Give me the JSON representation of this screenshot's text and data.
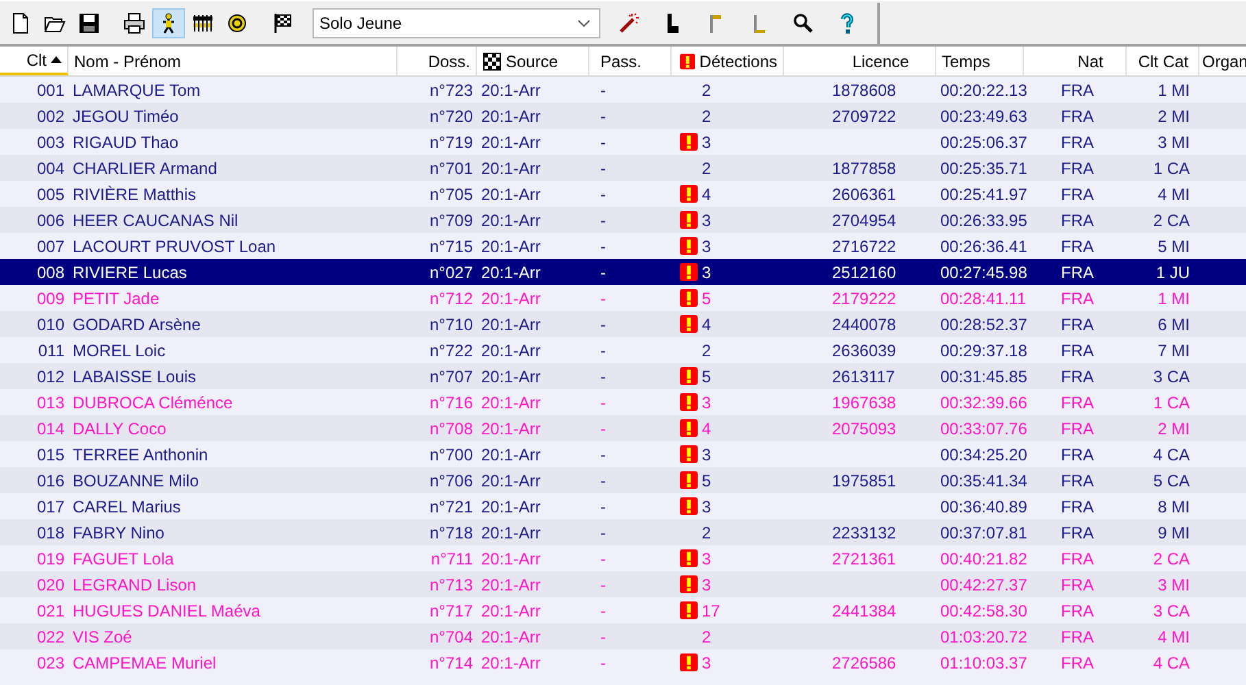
{
  "toolbar": {
    "views": [
      {
        "selected": true
      },
      {
        "selected": false
      },
      {
        "selected": false
      }
    ],
    "dropdown": {
      "value": "Solo Jeune"
    },
    "tools": [
      {
        "selected": false
      },
      {
        "selected": false
      },
      {
        "selected": false
      },
      {
        "selected": false
      },
      {
        "selected": false
      },
      {
        "selected": false
      }
    ]
  },
  "table": {
    "columns": [
      "Clt",
      "Nom - Prénom",
      "Doss.",
      "Source",
      "Pass.",
      "Détections",
      "Licence",
      "Temps",
      "Nat",
      "Clt Cat",
      "Organ"
    ],
    "rows": [
      {
        "clt": "001",
        "name": "LAMARQUE Tom",
        "doss": "n°723",
        "source": "20:1-Arr",
        "pass": "-",
        "warning": false,
        "detections": "2",
        "licence": "1878608",
        "time": "00:20:22.13",
        "nat": "FRA",
        "clt_cat": "1 MI",
        "color": "#1c1c8c",
        "selected": false
      },
      {
        "clt": "002",
        "name": "JEGOU Timéo",
        "doss": "n°720",
        "source": "20:1-Arr",
        "pass": "-",
        "warning": false,
        "detections": "2",
        "licence": "2709722",
        "time": "00:23:49.63",
        "nat": "FRA",
        "clt_cat": "2 MI",
        "color": "#1c1c8c",
        "selected": false
      },
      {
        "clt": "003",
        "name": "RIGAUD Thao",
        "doss": "n°719",
        "source": "20:1-Arr",
        "pass": "-",
        "warning": true,
        "detections": "3",
        "licence": "",
        "time": "00:25:06.37",
        "nat": "FRA",
        "clt_cat": "3 MI",
        "color": "#1c1c8c",
        "selected": false
      },
      {
        "clt": "004",
        "name": "CHARLIER Armand",
        "doss": "n°701",
        "source": "20:1-Arr",
        "pass": "-",
        "warning": false,
        "detections": "2",
        "licence": "1877858",
        "time": "00:25:35.71",
        "nat": "FRA",
        "clt_cat": "1 CA",
        "color": "#1c1c8c",
        "selected": false
      },
      {
        "clt": "005",
        "name": "RIVIÈRE Matthis",
        "doss": "n°705",
        "source": "20:1-Arr",
        "pass": "-",
        "warning": true,
        "detections": "4",
        "licence": "2606361",
        "time": "00:25:41.97",
        "nat": "FRA",
        "clt_cat": "4 MI",
        "color": "#1c1c8c",
        "selected": false
      },
      {
        "clt": "006",
        "name": "HEER CAUCANAS Nil",
        "doss": "n°709",
        "source": "20:1-Arr",
        "pass": "-",
        "warning": true,
        "detections": "3",
        "licence": "2704954",
        "time": "00:26:33.95",
        "nat": "FRA",
        "clt_cat": "2 CA",
        "color": "#1c1c8c",
        "selected": false
      },
      {
        "clt": "007",
        "name": "LACOURT PRUVOST Loan",
        "doss": "n°715",
        "source": "20:1-Arr",
        "pass": "-",
        "warning": true,
        "detections": "3",
        "licence": "2716722",
        "time": "00:26:36.41",
        "nat": "FRA",
        "clt_cat": "5 MI",
        "color": "#1c1c8c",
        "selected": false
      },
      {
        "clt": "008",
        "name": "RIVIERE Lucas",
        "doss": "n°027",
        "source": "20:1-Arr",
        "pass": "-",
        "warning": true,
        "detections": "3",
        "licence": "2512160",
        "time": "00:27:45.98",
        "nat": "FRA",
        "clt_cat": "1 JU",
        "selected": true
      },
      {
        "clt": "009",
        "name": "PETIT Jade",
        "doss": "n°712",
        "source": "20:1-Arr",
        "pass": "-",
        "warning": true,
        "detections": "5",
        "licence": "2179222",
        "time": "00:28:41.11",
        "nat": "FRA",
        "clt_cat": "1 MI",
        "color": "#ff14c8",
        "selected": false
      },
      {
        "clt": "010",
        "name": "GODARD Arsène",
        "doss": "n°710",
        "source": "20:1-Arr",
        "pass": "-",
        "warning": true,
        "detections": "4",
        "licence": "2440078",
        "time": "00:28:52.37",
        "nat": "FRA",
        "clt_cat": "6 MI",
        "color": "#1c1c8c",
        "selected": false
      },
      {
        "clt": "011",
        "name": "MOREL Loic",
        "doss": "n°722",
        "source": "20:1-Arr",
        "pass": "-",
        "warning": false,
        "detections": "2",
        "licence": "2636039",
        "time": "00:29:37.18",
        "nat": "FRA",
        "clt_cat": "7 MI",
        "color": "#1c1c8c",
        "selected": false
      },
      {
        "clt": "012",
        "name": "LABAISSE Louis",
        "doss": "n°707",
        "source": "20:1-Arr",
        "pass": "-",
        "warning": true,
        "detections": "5",
        "licence": "2613117",
        "time": "00:31:45.85",
        "nat": "FRA",
        "clt_cat": "3 CA",
        "color": "#1c1c8c",
        "selected": false
      },
      {
        "clt": "013",
        "name": "DUBROCA Cléménce",
        "doss": "n°716",
        "source": "20:1-Arr",
        "pass": "-",
        "warning": true,
        "detections": "3",
        "licence": "1967638",
        "time": "00:32:39.66",
        "nat": "FRA",
        "clt_cat": "1 CA",
        "color": "#ff14c8",
        "selected": false
      },
      {
        "clt": "014",
        "name": "DALLY Coco",
        "doss": "n°708",
        "source": "20:1-Arr",
        "pass": "-",
        "warning": true,
        "detections": "4",
        "licence": "2075093",
        "time": "00:33:07.76",
        "nat": "FRA",
        "clt_cat": "2 MI",
        "color": "#ff14c8",
        "selected": false
      },
      {
        "clt": "015",
        "name": "TERREE Anthonin",
        "doss": "n°700",
        "source": "20:1-Arr",
        "pass": "-",
        "warning": true,
        "detections": "3",
        "licence": "",
        "time": "00:34:25.20",
        "nat": "FRA",
        "clt_cat": "4 CA",
        "color": "#1c1c8c",
        "selected": false
      },
      {
        "clt": "016",
        "name": "BOUZANNE Milo",
        "doss": "n°706",
        "source": "20:1-Arr",
        "pass": "-",
        "warning": true,
        "detections": "5",
        "licence": "1975851",
        "time": "00:35:41.34",
        "nat": "FRA",
        "clt_cat": "5 CA",
        "color": "#1c1c8c",
        "selected": false
      },
      {
        "clt": "017",
        "name": "CAREL Marius",
        "doss": "n°721",
        "source": "20:1-Arr",
        "pass": "-",
        "warning": true,
        "detections": "3",
        "licence": "",
        "time": "00:36:40.89",
        "nat": "FRA",
        "clt_cat": "8 MI",
        "color": "#1c1c8c",
        "selected": false
      },
      {
        "clt": "018",
        "name": "FABRY Nino",
        "doss": "n°718",
        "source": "20:1-Arr",
        "pass": "-",
        "warning": false,
        "detections": "2",
        "licence": "2233132",
        "time": "00:37:07.81",
        "nat": "FRA",
        "clt_cat": "9 MI",
        "color": "#1c1c8c",
        "selected": false
      },
      {
        "clt": "019",
        "name": "FAGUET Lola",
        "doss": "n°711",
        "source": "20:1-Arr",
        "pass": "-",
        "warning": true,
        "detections": "3",
        "licence": "2721361",
        "time": "00:40:21.82",
        "nat": "FRA",
        "clt_cat": "2 CA",
        "color": "#ff14c8",
        "selected": false
      },
      {
        "clt": "020",
        "name": "LEGRAND Lison",
        "doss": "n°713",
        "source": "20:1-Arr",
        "pass": "-",
        "warning": true,
        "detections": "3",
        "licence": "",
        "time": "00:42:27.37",
        "nat": "FRA",
        "clt_cat": "3 MI",
        "color": "#ff14c8",
        "selected": false
      },
      {
        "clt": "021",
        "name": "HUGUES DANIEL Maéva",
        "doss": "n°717",
        "source": "20:1-Arr",
        "pass": "-",
        "warning": true,
        "detections": "17",
        "licence": "2441384",
        "time": "00:42:58.30",
        "nat": "FRA",
        "clt_cat": "3 CA",
        "color": "#ff14c8",
        "selected": false
      },
      {
        "clt": "022",
        "name": "VIS Zoé",
        "doss": "n°704",
        "source": "20:1-Arr",
        "pass": "-",
        "warning": false,
        "detections": "2",
        "licence": "",
        "time": "01:03:20.72",
        "nat": "FRA",
        "clt_cat": "4 MI",
        "color": "#ff14c8",
        "selected": false
      },
      {
        "clt": "023",
        "name": "CAMPEMAE Muriel",
        "doss": "n°714",
        "source": "20:1-Arr",
        "pass": "-",
        "warning": true,
        "detections": "3",
        "licence": "2726586",
        "time": "01:10:03.37",
        "nat": "FRA",
        "clt_cat": "4 CA",
        "color": "#ff14c8",
        "selected": false
      }
    ]
  }
}
